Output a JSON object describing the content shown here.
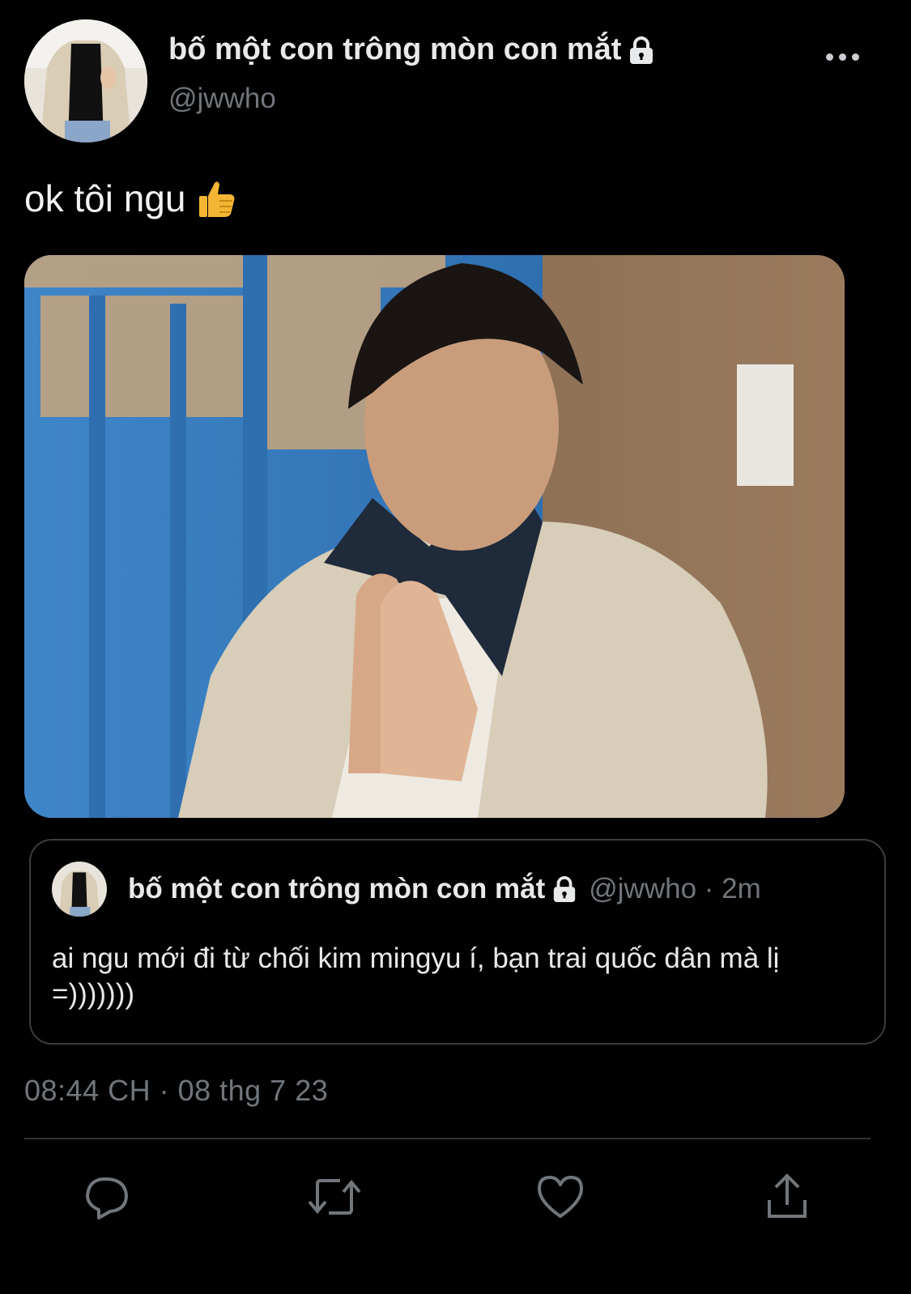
{
  "tweet": {
    "display_name": "bố một con trông mòn con mắt",
    "handle": "@jwwho",
    "text": "ok tôi ngu",
    "emoji": "👍",
    "timestamp": "08:44 CH · 08 thg 7 23"
  },
  "quoted_tweet": {
    "display_name": "bố một con trông mòn con mắt",
    "meta": "@jwwho · 2m",
    "text": "ai ngu mới đi từ chối kim mingyu í, bạn trai quốc dân mà lị =)))))))"
  },
  "icons": {
    "lock": "lock-icon",
    "more": "more-icon",
    "reply": "reply-icon",
    "retweet": "retweet-icon",
    "like": "like-icon",
    "share": "share-icon"
  },
  "colors": {
    "background": "#000000",
    "text": "#e7e9ea",
    "muted": "#71767b",
    "border": "#2f3336"
  }
}
